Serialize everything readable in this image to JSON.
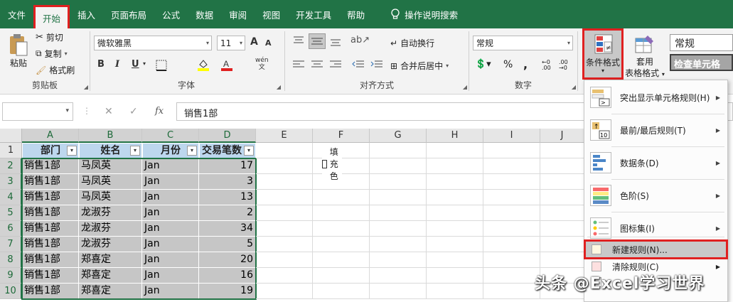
{
  "tabs": [
    "文件",
    "开始",
    "插入",
    "页面布局",
    "公式",
    "数据",
    "审阅",
    "视图",
    "开发工具",
    "帮助"
  ],
  "tell_me": "操作说明搜索",
  "clipboard": {
    "paste": "粘贴",
    "cut": "剪切",
    "copy": "复制",
    "format_painter": "格式刷",
    "label": "剪贴板"
  },
  "font": {
    "name": "微软雅黑",
    "size": "11",
    "bold": "B",
    "italic": "I",
    "underline": "U",
    "label": "字体",
    "font_increase": "A",
    "font_decrease": "A",
    "phonetic": "wén"
  },
  "align": {
    "wrap": "自动换行",
    "merge": "合并后居中",
    "label": "对齐方式"
  },
  "number": {
    "format": "常规",
    "label": "数字",
    "percent": "%",
    "comma": ","
  },
  "styles": {
    "cond_fmt": "条件格式",
    "table_fmt": "套用",
    "table_fmt2": "表格格式",
    "style_normal": "常规",
    "style_check": "检查单元格"
  },
  "formula_bar": {
    "cancel": "✕",
    "enter": "✓",
    "fx": "fx",
    "value": "销售1部"
  },
  "columns": [
    "A",
    "B",
    "C",
    "D",
    "E",
    "F",
    "G",
    "H",
    "I",
    "J"
  ],
  "rows": [
    "1",
    "2",
    "3",
    "4",
    "5",
    "6",
    "7",
    "8",
    "9",
    "10"
  ],
  "headers": [
    "部门",
    "姓名",
    "月份",
    "交易笔数"
  ],
  "table": [
    [
      "销售1部",
      "马凤英",
      "Jan",
      "17"
    ],
    [
      "销售1部",
      "马凤英",
      "Jan",
      "3"
    ],
    [
      "销售1部",
      "马凤英",
      "Jan",
      "13"
    ],
    [
      "销售1部",
      "龙淑芬",
      "Jan",
      "2"
    ],
    [
      "销售1部",
      "龙淑芬",
      "Jan",
      "34"
    ],
    [
      "销售1部",
      "龙淑芬",
      "Jan",
      "5"
    ],
    [
      "销售1部",
      "郑喜定",
      "Jan",
      "20"
    ],
    [
      "销售1部",
      "郑喜定",
      "Jan",
      "16"
    ],
    [
      "销售1部",
      "郑喜定",
      "Jan",
      "19"
    ]
  ],
  "checkbox_label": "填充色",
  "menu": {
    "highlight": "突出显示单元格规则(H)",
    "topbottom": "最前/最后规则(T)",
    "databars": "数据条(D)",
    "colorscales": "色阶(S)",
    "iconsets": "图标集(I)",
    "newrule": "新建规则(N)...",
    "clearrule": "清除规则(C)"
  },
  "watermark": "头条 @Excel学习世界",
  "colors": {
    "excel_green": "#217346",
    "red_highlight": "#e02020"
  }
}
